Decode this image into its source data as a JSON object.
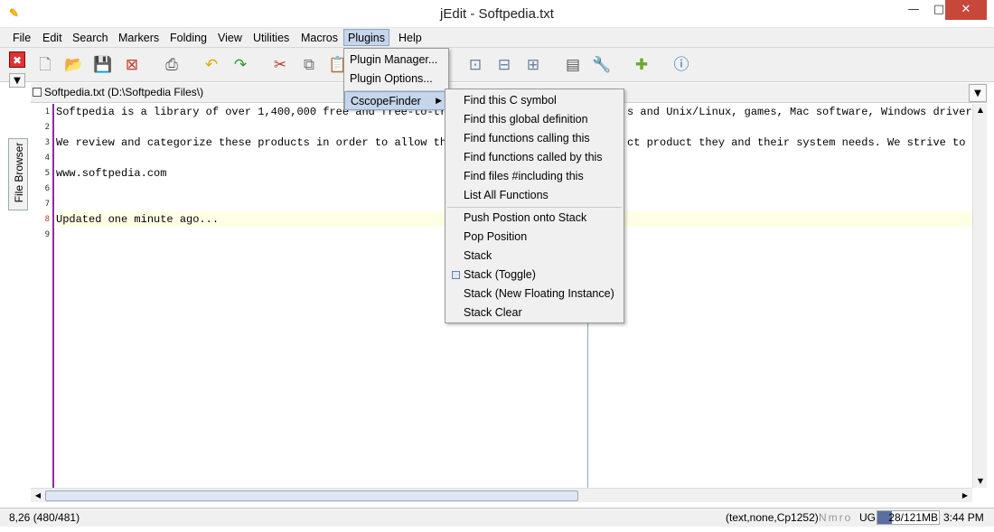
{
  "window": {
    "title": "jEdit - Softpedia.txt",
    "icon": "jedit-icon",
    "min_glyph": "—",
    "max_glyph": "□",
    "close_glyph": "✕"
  },
  "menubar": {
    "items": [
      "File",
      "Edit",
      "Search",
      "Markers",
      "Folding",
      "View",
      "Utilities",
      "Macros",
      "Plugins",
      "Help"
    ],
    "active": "Plugins"
  },
  "toolbar": {
    "icons": [
      "new-file-icon",
      "open-file-icon",
      "save-icon",
      "close-file-icon",
      "print-icon",
      "undo-icon",
      "redo-icon",
      "cut-icon",
      "copy-icon",
      "paste-icon",
      "split-horizontal-icon",
      "split-vertical-icon",
      "unsplit-icon",
      "buffer-options-icon",
      "global-options-icon",
      "plugin-manager-icon",
      "help-icon"
    ]
  },
  "side_dock": {
    "tab_label": "File Browser",
    "close_glyph": "✖",
    "arrow_glyph": "▼"
  },
  "buffer": {
    "title": "Softpedia.txt (D:\\Softpedia Files\\)",
    "dropdown_glyph": "▼"
  },
  "editor": {
    "lines": [
      {
        "num": "1",
        "text": "Softpedia is a library of over 1,400,000 free and free-to-try"
      },
      {
        "num": "2",
        "text": ""
      },
      {
        "num": "3",
        "text": "We review and categorize these products in order to allow the"
      },
      {
        "num": "4",
        "text": ""
      },
      {
        "num": "5",
        "text": "www.softpedia.com"
      },
      {
        "num": "6",
        "text": ""
      },
      {
        "num": "7",
        "text": ""
      },
      {
        "num": "8",
        "text": "Updated one minute ago..."
      },
      {
        "num": "9",
        "text": ""
      }
    ],
    "right_pane": {
      "line1": "s and Unix/Linux, games, Mac software, Windows drivers,",
      "line3": "ct product they and their system needs. We strive to de"
    },
    "current_line": "8"
  },
  "plugins_menu": {
    "items": [
      "Plugin Manager...",
      "Plugin Options...",
      "CscopeFinder"
    ],
    "submenu_arrow": "▶"
  },
  "cscope_menu": {
    "group1": [
      "Find this C symbol",
      "Find this global definition",
      "Find functions calling this",
      "Find functions called by this",
      "Find files #including this",
      "List All Functions"
    ],
    "group2": [
      "Push Postion onto Stack",
      "Pop Position",
      "Stack",
      "Stack (Toggle)",
      "Stack (New Floating Instance)",
      "Stack Clear"
    ]
  },
  "statusbar": {
    "caret": "8,26 (480/481)",
    "mode": "(text,none,Cp1252)",
    "flags": "Nmro",
    "encoding": "UG",
    "memory": "28/121MB",
    "memory_fraction": 0.23,
    "time": "3:44 PM"
  },
  "scroll_glyphs": {
    "up": "▲",
    "down": "▼",
    "left": "◀",
    "right": "▶"
  }
}
